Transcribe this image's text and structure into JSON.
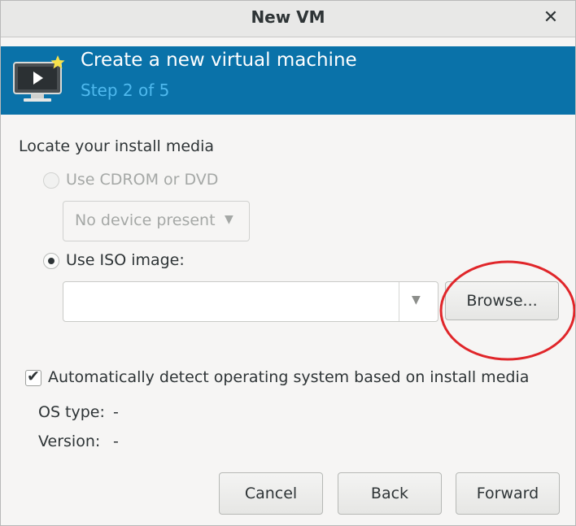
{
  "window": {
    "title": "New VM"
  },
  "banner": {
    "heading": "Create a new virtual machine",
    "step": "Step 2 of 5"
  },
  "section": {
    "label": "Locate your install media"
  },
  "cdrom": {
    "label": "Use CDROM or DVD",
    "selected": false,
    "enabled": false,
    "device_value": "No device present"
  },
  "iso": {
    "label": "Use ISO image:",
    "selected": true,
    "path_value": "",
    "browse_label": "Browse..."
  },
  "autodetect": {
    "label": "Automatically detect operating system based on install media",
    "checked": true
  },
  "os_info": {
    "os_type_label": "OS type:",
    "os_type_value": "-",
    "version_label": "Version:",
    "version_value": "-"
  },
  "buttons": {
    "cancel": "Cancel",
    "back": "Back",
    "forward": "Forward"
  },
  "colors": {
    "banner": "#0a72a9",
    "step_text": "#4fb9ee",
    "annotation_circle": "#e0262a"
  }
}
